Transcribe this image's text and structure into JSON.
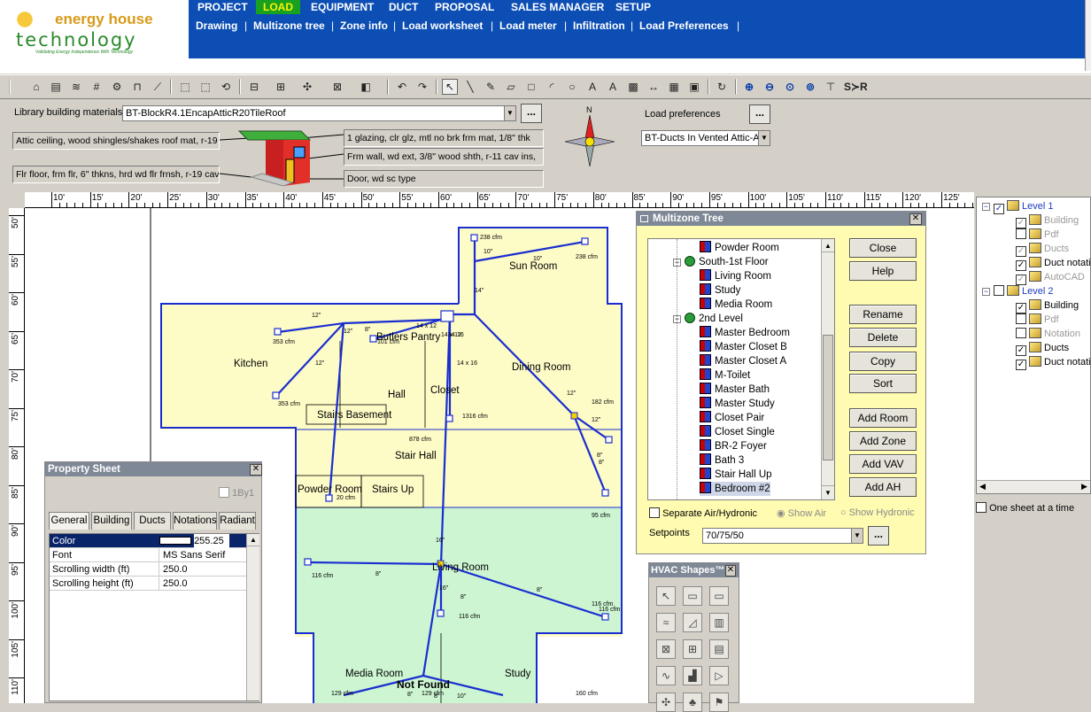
{
  "brand": {
    "line1": "energy house",
    "line2": "technology",
    "tagline": "Validating Energy Independence With Technology"
  },
  "nav": {
    "tabs": [
      "PROJECT",
      "LOAD",
      "EQUIPMENT",
      "DUCT",
      "PROPOSAL",
      "SALES MANAGER",
      "SETUP"
    ],
    "active_tab": "LOAD",
    "subtabs": [
      "Drawing",
      "Multizone tree",
      "Zone info",
      "Load worksheet",
      "Load meter",
      "Infiltration",
      "Load Preferences"
    ]
  },
  "library": {
    "label": "Library building materials",
    "value": "BT-BlockR4.1EncapAtticR20TileRoof",
    "ceiling": "Attic ceiling, wood shingles/shakes roof mat, r-19",
    "floor": "Flr floor, frm flr, 6\" thkns, hrd wd flr frnsh, r-19 cav",
    "glazing": "1 glazing, clr glz, mtl no brk frm mat, 1/8\" thk",
    "wall": "Frm wall, wd ext, 3/8\" wood shth, r-11 cav ins,",
    "door": "Door, wd sc type",
    "dots": "..."
  },
  "load_prefs": {
    "label": "Load preferences",
    "value": "BT-Ducts In Vented Attic-A",
    "dots": "..."
  },
  "ruler": {
    "h": [
      "10'",
      "15'",
      "20'",
      "25'",
      "30'",
      "35'",
      "40'",
      "45'",
      "50'",
      "55'",
      "60'",
      "65'",
      "70'",
      "75'",
      "80'",
      "85'",
      "90'",
      "95'",
      "100'",
      "105'",
      "110'",
      "115'",
      "120'",
      "125'"
    ],
    "v": [
      "50'",
      "55'",
      "60'",
      "65'",
      "70'",
      "75'",
      "80'",
      "85'",
      "90'",
      "95'",
      "100'",
      "105'",
      "110'"
    ]
  },
  "plan": {
    "rooms": [
      "Sun Room",
      "Kitchen",
      "Butlers Pantry",
      "Dining Room",
      "Hall",
      "Closet",
      "Stairs Basement",
      "Stair Hall",
      "Powder Room",
      "Stairs Up",
      "Living Room",
      "Media Room",
      "Study"
    ],
    "not_found": "Not Found",
    "airflows": [
      "238 cfm",
      "238 cfm",
      "353 cfm",
      "101 cfm",
      "353 cfm",
      "1316 cfm",
      "878 cfm",
      "182 cfm",
      "20 cfm",
      "95 cfm",
      "116 cfm",
      "116 cfm",
      "116 cfm",
      "116 cfm",
      "129 cfm",
      "129 cfm",
      "160 cfm"
    ],
    "duct_sizes": [
      "10\"",
      "10\"",
      "14\"",
      "12\"",
      "12\"",
      "8\"",
      "12\"",
      "14 x 12",
      "14 x 12",
      "14",
      "16",
      "14 x 16",
      "12\"",
      "12\"",
      "16\"",
      "8\"",
      "8\"",
      "8\"",
      "8\"",
      "8\"",
      "16\"",
      "8\"",
      "8\"",
      "10\""
    ]
  },
  "multizone": {
    "title": "Multizone Tree",
    "tree": [
      {
        "label": "Powder Room",
        "type": "room"
      },
      {
        "label": "South-1st Floor",
        "type": "zone"
      },
      {
        "label": "Living Room",
        "type": "room"
      },
      {
        "label": "Study",
        "type": "room"
      },
      {
        "label": "Media Room",
        "type": "room"
      },
      {
        "label": "2nd Level",
        "type": "zone"
      },
      {
        "label": "Master Bedroom",
        "type": "room"
      },
      {
        "label": "Master Closet B",
        "type": "room"
      },
      {
        "label": "Master Closet A",
        "type": "room"
      },
      {
        "label": "M-Toilet",
        "type": "room"
      },
      {
        "label": "Master Bath",
        "type": "room"
      },
      {
        "label": "Master Study",
        "type": "room"
      },
      {
        "label": "Closet Pair",
        "type": "room"
      },
      {
        "label": "Closet Single",
        "type": "room"
      },
      {
        "label": "BR-2 Foyer",
        "type": "room"
      },
      {
        "label": "Bath 3",
        "type": "room"
      },
      {
        "label": "Stair Hall Up",
        "type": "room"
      },
      {
        "label": "Bedroom #2",
        "type": "room"
      }
    ],
    "buttons": [
      "Close",
      "Help",
      "Rename",
      "Delete",
      "Copy",
      "Sort",
      "Add Room",
      "Add Zone",
      "Add VAV",
      "Add AH"
    ],
    "separate_label": "Separate Air/Hydronic",
    "show_air": "Show Air",
    "show_hydronic": "Show Hydronic",
    "setpoints_label": "Setpoints",
    "setpoints_value": "70/75/50",
    "dots": "..."
  },
  "hvac": {
    "title": "HVAC Shapes™",
    "shapes": [
      "pointer",
      "room",
      "room",
      "wind",
      "door",
      "vent",
      "box",
      "grid",
      "wall",
      "coil",
      "unit",
      "arrow",
      "fan",
      "tree",
      "flag"
    ]
  },
  "property": {
    "title": "Property Sheet",
    "check_label": "1By1",
    "tabs": [
      "General",
      "Building",
      "Ducts",
      "Notations",
      "Radiant"
    ],
    "rows": [
      {
        "name": "Color",
        "value": "255.25"
      },
      {
        "name": "Font",
        "value": "MS Sans Serif"
      },
      {
        "name": "Scrolling width (ft)",
        "value": "250.0"
      },
      {
        "name": "Scrolling height (ft)",
        "value": "250.0"
      }
    ]
  },
  "layers": {
    "items": [
      {
        "label": "Level 1",
        "checked": true,
        "indent": 0,
        "enabled": true
      },
      {
        "label": "Building",
        "checked": true,
        "indent": 1,
        "enabled": false
      },
      {
        "label": "Pdf",
        "checked": false,
        "indent": 1,
        "enabled": false
      },
      {
        "label": "Ducts",
        "checked": true,
        "indent": 1,
        "enabled": false
      },
      {
        "label": "Duct notation",
        "checked": true,
        "indent": 1,
        "enabled": true
      },
      {
        "label": "AutoCAD",
        "checked": true,
        "indent": 1,
        "enabled": false
      },
      {
        "label": "Level 2",
        "checked": false,
        "indent": 0,
        "enabled": true
      },
      {
        "label": "Building",
        "checked": true,
        "indent": 1,
        "enabled": true
      },
      {
        "label": "Pdf",
        "checked": false,
        "indent": 1,
        "enabled": false
      },
      {
        "label": "Notation",
        "checked": false,
        "indent": 1,
        "enabled": false
      },
      {
        "label": "Ducts",
        "checked": true,
        "indent": 1,
        "enabled": true
      },
      {
        "label": "Duct notation",
        "checked": true,
        "indent": 1,
        "enabled": true
      }
    ],
    "one_sheet_label": "One sheet at a time"
  },
  "colors": {
    "nav_bg": "#0c4eb4",
    "active_tab": "#18a020",
    "active_text": "#fff200",
    "zone_yellow": "#fdfbc6",
    "zone_green": "#cdf5d2",
    "duct_blue": "#1a2ed0",
    "window_yellow": "#fffbb0"
  }
}
